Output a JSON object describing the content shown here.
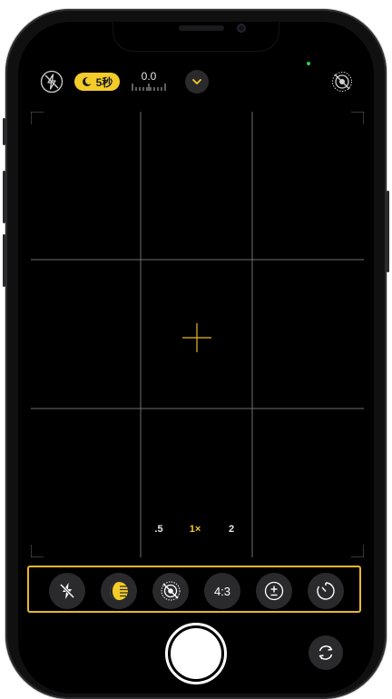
{
  "top_bar": {
    "flash_icon": "flash-off-icon",
    "exposure_pill_label": "5秒",
    "exposure_value": "0.0",
    "chevron_icon": "chevron-down-icon",
    "live_icon": "live-photo-off-icon"
  },
  "zoom": {
    "options": [
      ".5",
      "1×",
      "2"
    ],
    "selected": "1×"
  },
  "controls": {
    "items": [
      {
        "name": "flash-off",
        "icon": "flash-off-icon",
        "label": ""
      },
      {
        "name": "night-mode",
        "icon": "night-mode-icon",
        "label": ""
      },
      {
        "name": "live-photo",
        "icon": "live-photo-off-icon",
        "label": ""
      },
      {
        "name": "aspect-ratio",
        "icon": "",
        "label": "4:3"
      },
      {
        "name": "exposure",
        "icon": "exposure-icon",
        "label": ""
      },
      {
        "name": "timer",
        "icon": "timer-icon",
        "label": ""
      }
    ]
  },
  "colors": {
    "accent": "#f4cc2a",
    "tray_border": "#e8b82a",
    "control_bg": "#2a2a2c",
    "screen_bg": "#000000"
  }
}
